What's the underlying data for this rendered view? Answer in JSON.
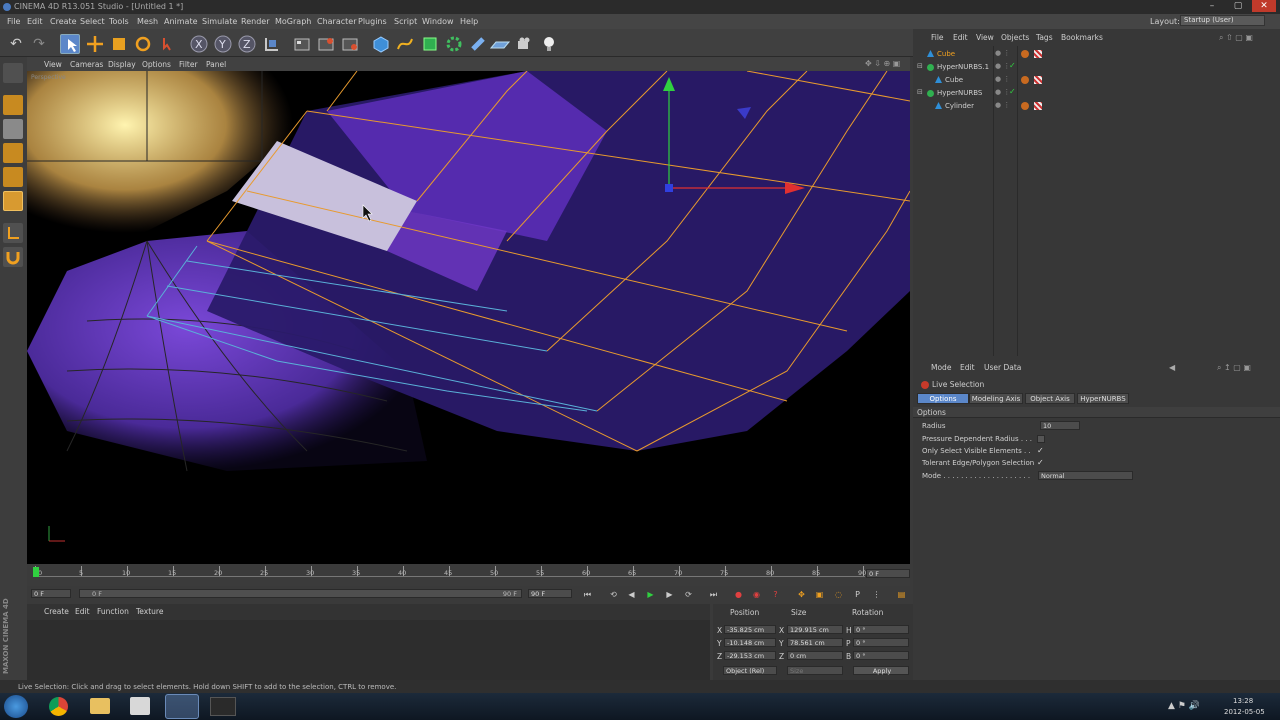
{
  "title_bar": {
    "title": "CINEMA 4D R13.051 Studio - [Untitled 1 *]",
    "minimize": "–",
    "maximize": "▢",
    "close": "✕"
  },
  "menu": {
    "items": [
      "File",
      "Edit",
      "Create",
      "Select",
      "Tools",
      "Mesh",
      "Animate",
      "Simulate",
      "Render",
      "MoGraph",
      "Character",
      "Plugins",
      "Script",
      "Window",
      "Help"
    ],
    "layout_label": "Layout:",
    "layout_value": "Startup (User)"
  },
  "viewport": {
    "menu": [
      "View",
      "Cameras",
      "Display",
      "Options",
      "Filter",
      "Panel"
    ],
    "label": "Perspective"
  },
  "timeline": {
    "ticks": [
      "0",
      "5",
      "10",
      "15",
      "20",
      "25",
      "30",
      "35",
      "40",
      "45",
      "50",
      "55",
      "60",
      "65",
      "70",
      "75",
      "80",
      "85",
      "90"
    ],
    "current_frame": "0 F",
    "start_field": "0 F",
    "start_min": "0 F",
    "end_field": "90 F",
    "end_max": "90 F"
  },
  "material_manager": {
    "menu": [
      "Create",
      "Edit",
      "Function",
      "Texture"
    ]
  },
  "coordinates": {
    "headers": [
      "Position",
      "Size",
      "Rotation"
    ],
    "rows": [
      {
        "axis": "X",
        "position": "-35.825 cm",
        "size_axis": "X",
        "size": "129.915 cm",
        "rot_axis": "H",
        "rotation": "0 °"
      },
      {
        "axis": "Y",
        "position": "-10.148 cm",
        "size_axis": "Y",
        "size": "78.561 cm",
        "rot_axis": "P",
        "rotation": "0 °"
      },
      {
        "axis": "Z",
        "position": "-29.153 cm",
        "size_axis": "Z",
        "size": "0 cm",
        "rot_axis": "B",
        "rotation": "0 °"
      }
    ],
    "mode_select": "Object (Rel)",
    "size_select": "Size",
    "apply": "Apply"
  },
  "object_manager": {
    "menu": [
      "File",
      "Edit",
      "View",
      "Objects",
      "Tags",
      "Bookmarks"
    ],
    "objects": [
      {
        "name": "Cube",
        "indent": 0,
        "selected": true
      },
      {
        "name": "HyperNURBS.1",
        "indent": 0,
        "selected": false
      },
      {
        "name": "Cube",
        "indent": 1,
        "selected": false
      },
      {
        "name": "HyperNURBS",
        "indent": 0,
        "selected": false
      },
      {
        "name": "Cylinder",
        "indent": 1,
        "selected": false
      }
    ]
  },
  "attribute_manager": {
    "menu": [
      "Mode",
      "Edit",
      "User Data"
    ],
    "tool_name": "Live Selection",
    "tabs": [
      "Options",
      "Modeling Axis",
      "Object Axis",
      "HyperNURBS"
    ],
    "section": "Options",
    "radius_label": "Radius",
    "radius_value": "10",
    "pressure_label": "Pressure Dependent Radius . . .",
    "visible_label": "Only Select Visible Elements . .",
    "tolerant_label": "Tolerant Edge/Polygon Selection",
    "mode_label": "Mode . . . . . . . . . . . . . . . . . . . .",
    "mode_value": "Normal",
    "visible_check": "✓",
    "tolerant_check": "✓"
  },
  "status_bar": {
    "text": "Live Selection: Click and drag to select elements. Hold down SHIFT to add to the selection, CTRL to remove."
  },
  "taskbar": {
    "time": "13:28",
    "date": "2012-05-05"
  },
  "brand": {
    "logo": "MAXON CINEMA 4D"
  },
  "colors": {
    "accent_blue": "#5b87c9",
    "axis_red": "#e03030",
    "axis_green": "#30d040",
    "axis_blue": "#3040e0",
    "wire_orange": "#e89a2e"
  }
}
